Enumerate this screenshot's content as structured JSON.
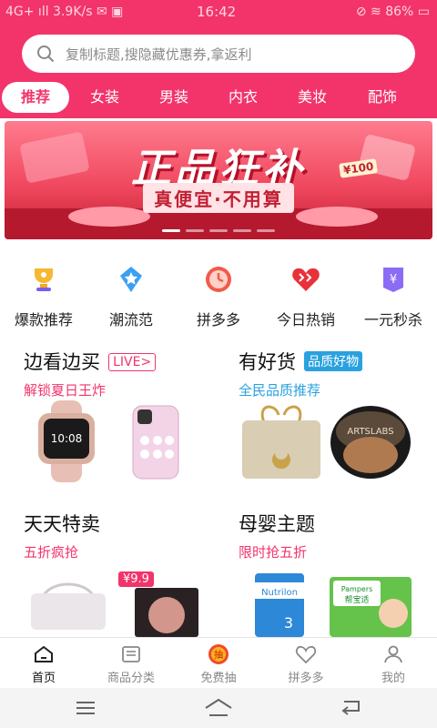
{
  "status": {
    "left": "4G+ ıll  3.9K/s  ✉ ▣",
    "time": "16:42",
    "right": "⊘ ≋ 86% ▭"
  },
  "search": {
    "placeholder": "复制标题,搜隐藏优惠券,拿返利"
  },
  "tabs": [
    {
      "label": "推荐"
    },
    {
      "label": "女装"
    },
    {
      "label": "男装"
    },
    {
      "label": "内衣"
    },
    {
      "label": "美妆"
    },
    {
      "label": "配饰"
    }
  ],
  "banner": {
    "title": "正品狂补",
    "subtitle": "真便宜·不用算",
    "tag": "¥100"
  },
  "categories": [
    {
      "label": "爆款推荐",
      "icon": "trophy-icon"
    },
    {
      "label": "潮流范",
      "icon": "star-tag-icon"
    },
    {
      "label": "拼多多",
      "icon": "clock-icon"
    },
    {
      "label": "今日热销",
      "icon": "heart-icon"
    },
    {
      "label": "一元秒杀",
      "icon": "yen-tag-icon"
    }
  ],
  "cards": [
    {
      "title": "边看边买",
      "badge": "LIVE>",
      "subtitle": "解锁夏日王炸"
    },
    {
      "title": "有好货",
      "badge": "品质好物",
      "subtitle": "全民品质推荐"
    },
    {
      "title": "天天特卖",
      "subtitle": "五折疯抢"
    },
    {
      "title": "母婴主题",
      "subtitle": "限时抢五折"
    }
  ],
  "price_tag": "¥9.9",
  "product_text": {
    "compact_brand": "ARTSLABS",
    "formula_brand": "Nutrilon",
    "formula_stage": "3",
    "diaper_brand": "Pampers",
    "diaper_cn": "帮宝适"
  },
  "bottom_nav": [
    {
      "label": "首页",
      "icon": "home-icon",
      "active": true
    },
    {
      "label": "商品分类",
      "icon": "list-icon"
    },
    {
      "label": "免费抽",
      "icon": "lottery-icon"
    },
    {
      "label": "拼多多",
      "icon": "pdd-icon"
    },
    {
      "label": "我的",
      "icon": "user-icon"
    }
  ],
  "colors": {
    "brand": "#f2346b",
    "accent_blue": "#2aa1e0"
  }
}
